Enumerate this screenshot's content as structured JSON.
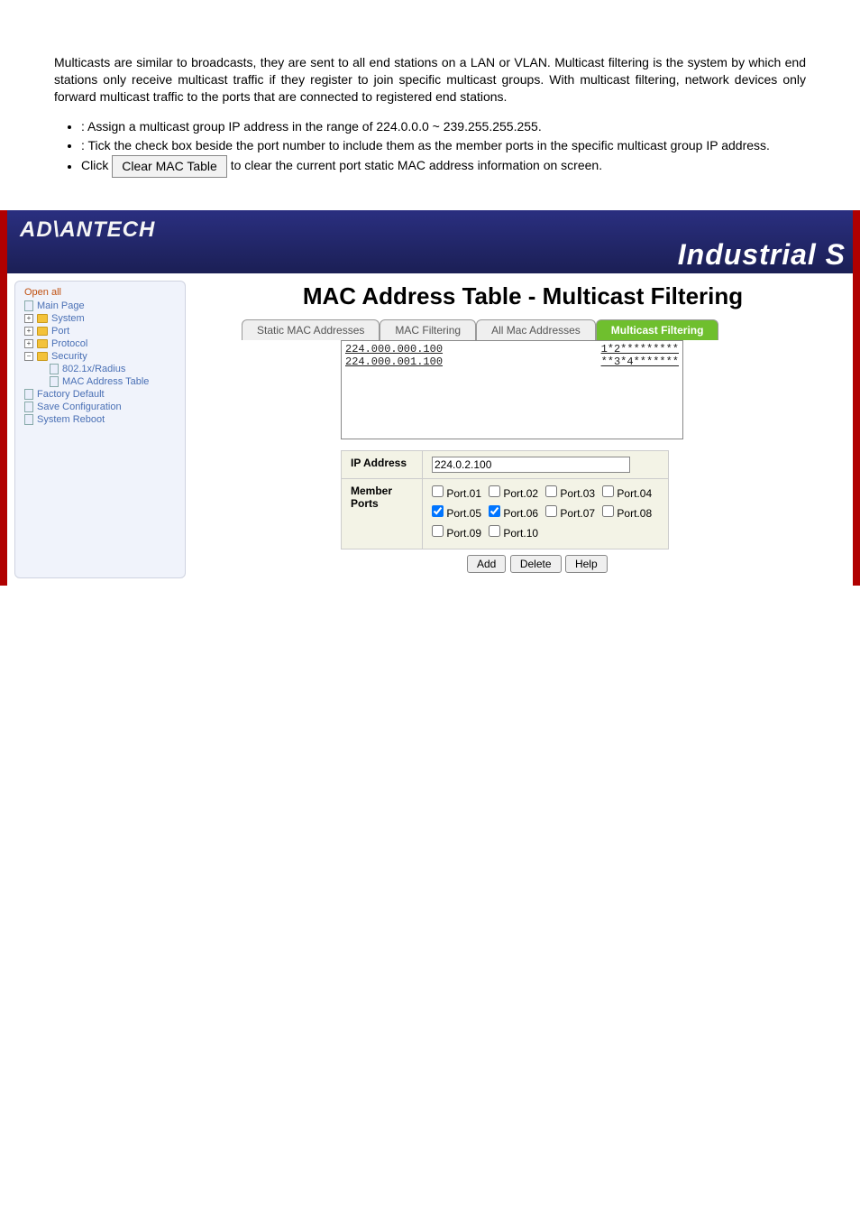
{
  "intro": "Multicasts are similar to broadcasts, they are sent to all end stations on a LAN or VLAN. Multicast filtering is the system by which end stations only receive multicast traffic if they register to join specific multicast groups. With multicast filtering, network devices only forward multicast traffic to the ports that are connected to registered end stations.",
  "bullets": {
    "ip_desc": ": Assign a multicast group IP address in the range of 224.0.0.0 ~ 239.255.255.255.",
    "member_desc": ": Tick the check box beside the port number to include them as the member ports in the specific multicast group IP address.",
    "click_prefix": "Click",
    "clear_btn": "Clear MAC Table",
    "click_suffix": "to clear the current port static MAC address information on screen."
  },
  "brand": "AD\\ANTECH",
  "brand_right": "Industrial S",
  "sidebar": {
    "open_all": "Open all",
    "items": [
      "Main Page",
      "System",
      "Port",
      "Protocol",
      "Security",
      "802.1x/Radius",
      "MAC Address Table",
      "Factory Default",
      "Save Configuration",
      "System Reboot"
    ]
  },
  "page_title": "MAC Address Table - Multicast Filtering",
  "tabs": [
    "Static MAC Addresses",
    "MAC Filtering",
    "All Mac Addresses",
    "Multicast Filtering"
  ],
  "list": [
    {
      "ip": "224.000.000.100",
      "members": "1*2*********"
    },
    {
      "ip": "224.000.001.100",
      "members": "**3*4*******"
    }
  ],
  "form": {
    "ip_label": "IP Address",
    "ip_value": "224.0.2.100",
    "member_label": "Member Ports",
    "ports": [
      {
        "label": "Port.01",
        "checked": false
      },
      {
        "label": "Port.02",
        "checked": false
      },
      {
        "label": "Port.03",
        "checked": false
      },
      {
        "label": "Port.04",
        "checked": false
      },
      {
        "label": "Port.05",
        "checked": true
      },
      {
        "label": "Port.06",
        "checked": true
      },
      {
        "label": "Port.07",
        "checked": false
      },
      {
        "label": "Port.08",
        "checked": false
      },
      {
        "label": "Port.09",
        "checked": false
      },
      {
        "label": "Port.10",
        "checked": false
      }
    ]
  },
  "buttons": {
    "add": "Add",
    "delete": "Delete",
    "help": "Help"
  }
}
